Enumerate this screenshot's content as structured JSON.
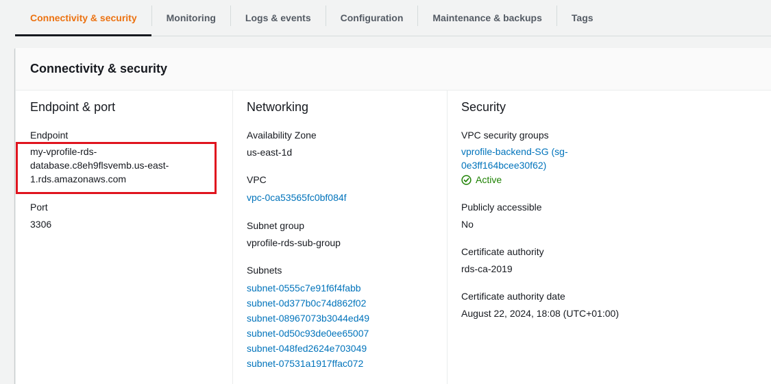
{
  "tabs": [
    {
      "label": "Connectivity & security",
      "active": true
    },
    {
      "label": "Monitoring"
    },
    {
      "label": "Logs & events"
    },
    {
      "label": "Configuration"
    },
    {
      "label": "Maintenance & backups"
    },
    {
      "label": "Tags"
    }
  ],
  "panel": {
    "title": "Connectivity & security",
    "endpoint_port": {
      "title": "Endpoint & port",
      "endpoint_label": "Endpoint",
      "endpoint_lines": [
        "my-vprofile-rds-",
        "database.c8eh9flsvemb.us-east-",
        "1.rds.amazonaws.com"
      ],
      "port_label": "Port",
      "port_value": "3306"
    },
    "networking": {
      "title": "Networking",
      "az_label": "Availability Zone",
      "az_value": "us-east-1d",
      "vpc_label": "VPC",
      "vpc_value": "vpc-0ca53565fc0bf084f",
      "subnet_group_label": "Subnet group",
      "subnet_group_value": "vprofile-rds-sub-group",
      "subnets_label": "Subnets",
      "subnets": [
        "subnet-0555c7e91f6f4fabb",
        "subnet-0d377b0c74d862f02",
        "subnet-08967073b3044ed49",
        "subnet-0d50c93de0ee65007",
        "subnet-048fed2624e703049",
        "subnet-07531a1917ffac072"
      ]
    },
    "security": {
      "title": "Security",
      "vpc_sg_label": "VPC security groups",
      "vpc_sg_lines": [
        "vprofile-backend-SG (sg-",
        "0e3ff164bcee30f62)"
      ],
      "sg_status": "Active",
      "public_label": "Publicly accessible",
      "public_value": "No",
      "ca_label": "Certificate authority",
      "ca_value": "rds-ca-2019",
      "ca_date_label": "Certificate authority date",
      "ca_date_value": "August 22, 2024, 18:08 (UTC+01:00)"
    }
  },
  "colors": {
    "accent": "#ec7211",
    "link": "#0073bb",
    "success": "#1d8102",
    "highlight": "#e0141e"
  }
}
